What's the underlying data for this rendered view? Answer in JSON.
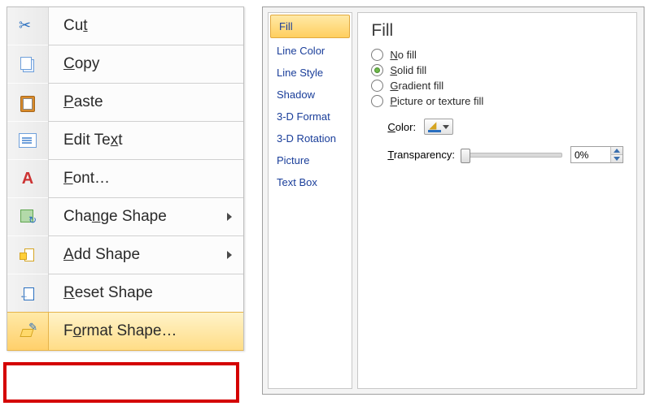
{
  "context_menu": {
    "items": [
      {
        "key": "cut",
        "label_pre": "Cu",
        "accel": "t",
        "label_post": ""
      },
      {
        "key": "copy",
        "label_pre": "",
        "accel": "C",
        "label_post": "opy"
      },
      {
        "key": "paste",
        "label_pre": "",
        "accel": "P",
        "label_post": "aste"
      },
      {
        "key": "edit-text",
        "label_pre": "Edit Te",
        "accel": "x",
        "label_post": "t"
      },
      {
        "key": "font",
        "label_pre": "",
        "accel": "F",
        "label_post": "ont…"
      },
      {
        "key": "change-shape",
        "label_pre": "Cha",
        "accel": "n",
        "label_post": "ge Shape",
        "submenu": true
      },
      {
        "key": "add-shape",
        "label_pre": "",
        "accel": "A",
        "label_post": "dd Shape",
        "submenu": true
      },
      {
        "key": "reset-shape",
        "label_pre": "",
        "accel": "R",
        "label_post": "eset Shape"
      },
      {
        "key": "format-shape",
        "label_pre": "F",
        "accel": "o",
        "label_post": "rmat Shape…",
        "highlighted": true
      }
    ]
  },
  "dialog": {
    "nav": {
      "items": [
        {
          "key": "fill",
          "label": "Fill",
          "selected": true
        },
        {
          "key": "line-color",
          "label": "Line Color"
        },
        {
          "key": "line-style",
          "label": "Line Style"
        },
        {
          "key": "shadow",
          "label": "Shadow"
        },
        {
          "key": "3d-format",
          "label": "3-D Format"
        },
        {
          "key": "3d-rotation",
          "label": "3-D Rotation"
        },
        {
          "key": "picture",
          "label": "Picture"
        },
        {
          "key": "text-box",
          "label": "Text Box"
        }
      ]
    },
    "pane": {
      "title": "Fill",
      "fill_options": {
        "no_fill": {
          "pre": "",
          "accel": "N",
          "post": "o fill"
        },
        "solid_fill": {
          "pre": "",
          "accel": "S",
          "post": "olid fill"
        },
        "gradient": {
          "pre": "",
          "accel": "G",
          "post": "radient fill"
        },
        "picture": {
          "pre": "",
          "accel": "P",
          "post": "icture or texture fill"
        }
      },
      "selected_fill": "solid_fill",
      "color_label": {
        "pre": "",
        "accel": "C",
        "post": "olor:"
      },
      "transparency_label": {
        "pre": "",
        "accel": "T",
        "post": "ransparency:"
      },
      "transparency_value": "0%"
    }
  }
}
